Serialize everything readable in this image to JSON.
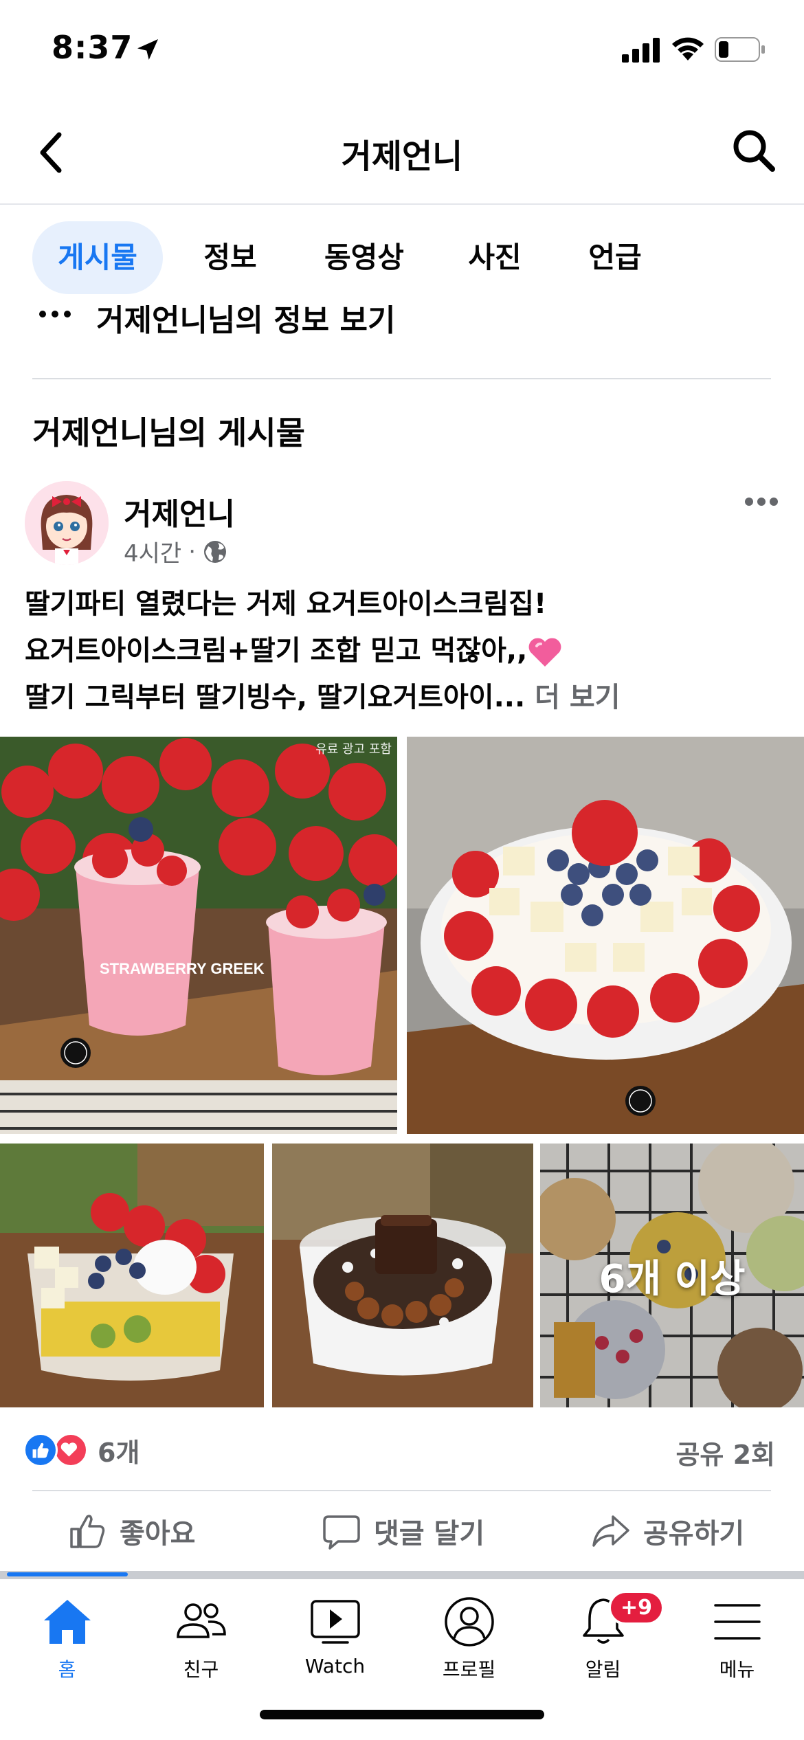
{
  "status_bar": {
    "time": "8:37"
  },
  "header": {
    "title": "거제언니"
  },
  "tabs": [
    {
      "label": "게시물",
      "active": true
    },
    {
      "label": "정보",
      "active": false
    },
    {
      "label": "동영상",
      "active": false
    },
    {
      "label": "사진",
      "active": false
    },
    {
      "label": "언급",
      "active": false
    }
  ],
  "info_row": {
    "text": "거제언니님의 정보 보기"
  },
  "section": {
    "title": "거제언니님의 게시물"
  },
  "post": {
    "author": "거제언니",
    "time": "4시간",
    "separator": "·",
    "privacy_icon": "globe-icon",
    "text_line_1": "딸기파티 열렸다는 거제 요거트아이스크림집!",
    "text_line_2": "요거트아이스크림+딸기 조합 믿고 먹잖아,,",
    "text_line_3": "딸기 그릭부터 딸기빙수, 딸기요거트아이...",
    "see_more": "더 보기",
    "photo_ad_label": "유료 광고 포함",
    "photo_cup_label": "STRAWBERRY GREEK",
    "photo_more_label": "6개 이상",
    "reaction_count": "6개",
    "share_count": "공유 2회",
    "actions": {
      "like": "좋아요",
      "comment": "댓글 달기",
      "share": "공유하기"
    }
  },
  "bottom_nav": [
    {
      "label": "홈",
      "icon": "home-icon",
      "active": true
    },
    {
      "label": "친구",
      "icon": "friends-icon",
      "active": false
    },
    {
      "label": "Watch",
      "icon": "watch-icon",
      "active": false
    },
    {
      "label": "프로필",
      "icon": "profile-icon",
      "active": false
    },
    {
      "label": "알림",
      "icon": "bell-icon",
      "active": false,
      "badge": "+9"
    },
    {
      "label": "메뉴",
      "icon": "menu-icon",
      "active": false
    }
  ],
  "colors": {
    "accent": "#1877f2",
    "secondary_text": "#65676b",
    "badge": "#e41e3f",
    "love": "#f33e58"
  }
}
